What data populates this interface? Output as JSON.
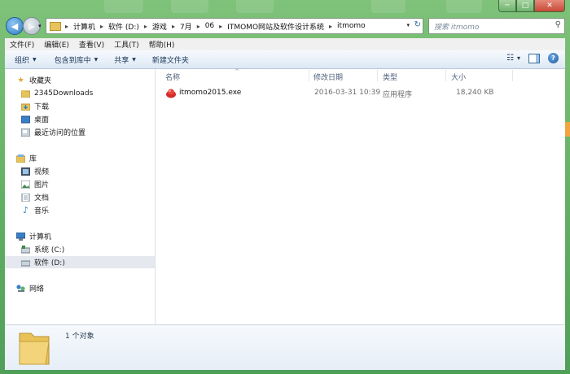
{
  "window": {
    "controls": {
      "minimize": "─",
      "maximize": "□",
      "close": "✕"
    }
  },
  "nav": {
    "back": "◀",
    "forward": "▶",
    "history_dropdown": "▾",
    "breadcrumb": [
      "计算机",
      "软件 (D:)",
      "游戏",
      "7月",
      "06",
      "ITMOMO网站及软件设计系统",
      "itmomo"
    ],
    "separator": "▸",
    "address_dropdown": "▾",
    "refresh": "↻",
    "search_placeholder": "搜索 itmomo",
    "search_icon": "⚲"
  },
  "menubar": [
    "文件(F)",
    "编辑(E)",
    "查看(V)",
    "工具(T)",
    "帮助(H)"
  ],
  "toolbar": {
    "organize": "组织",
    "include_library": "包含到库中",
    "share": "共享",
    "new_folder": "新建文件夹",
    "arrow": "▼",
    "views_icon": "☷",
    "views_arrow": "▾",
    "help": "?"
  },
  "sidebar": {
    "favorites": {
      "label": "收藏夹",
      "icon": "star-icon",
      "items": [
        {
          "label": "2345Downloads",
          "icon": "folder-icon"
        },
        {
          "label": "下载",
          "icon": "download-folder-icon"
        },
        {
          "label": "桌面",
          "icon": "desktop-icon"
        },
        {
          "label": "最近访问的位置",
          "icon": "recent-places-icon"
        }
      ]
    },
    "libraries": {
      "label": "库",
      "icon": "library-icon",
      "items": [
        {
          "label": "视频",
          "icon": "video-icon"
        },
        {
          "label": "图片",
          "icon": "pictures-icon"
        },
        {
          "label": "文档",
          "icon": "documents-icon"
        },
        {
          "label": "音乐",
          "icon": "music-icon"
        }
      ]
    },
    "computer": {
      "label": "计算机",
      "icon": "computer-icon",
      "items": [
        {
          "label": "系统 (C:)",
          "icon": "drive-c-icon"
        },
        {
          "label": "软件 (D:)",
          "icon": "drive-d-icon",
          "selected": true
        }
      ]
    },
    "network": {
      "label": "网络",
      "icon": "network-icon"
    }
  },
  "file_list": {
    "columns": [
      "名称",
      "修改日期",
      "类型",
      "大小"
    ],
    "sort_indicator": "^",
    "rows": [
      {
        "name": "itmomo2015.exe",
        "modified": "2016-03-31 10:39",
        "type": "应用程序",
        "size": "18,240 KB",
        "icon": "app-exe-icon"
      }
    ]
  },
  "status": {
    "count": "1 个对象"
  },
  "colors": {
    "frame": "#6bb56a",
    "accent": "#2f7cc5",
    "exe_icon": "#d42b2b"
  }
}
